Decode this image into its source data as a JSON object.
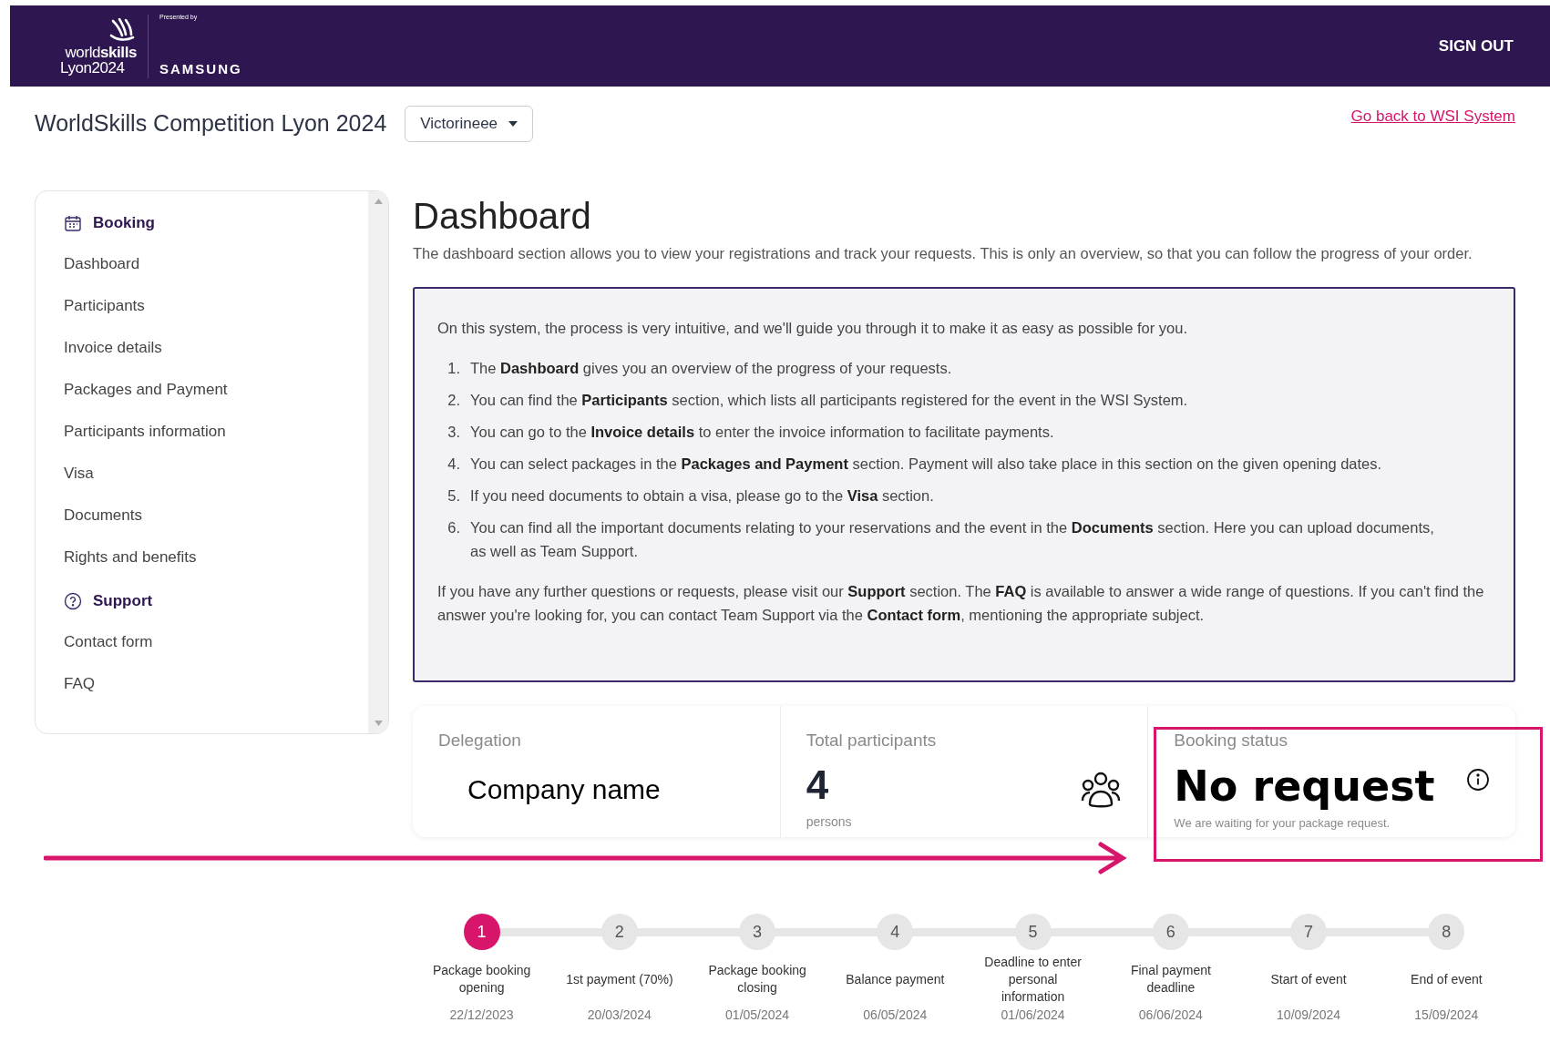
{
  "header": {
    "logo_line_1_light": "world",
    "logo_line_1_bold": "skills",
    "logo_line_2": "Lyon2024",
    "presented_by": "Presented by",
    "sponsor": "SAMSUNG",
    "sign_out": "SIGN OUT"
  },
  "title_bar": {
    "title": "WorldSkills Competition Lyon 2024",
    "dropdown": "Victorineee",
    "back_link": "Go back to WSI System"
  },
  "sidebar": {
    "sections": [
      {
        "title": "Booking",
        "kind": "calendar",
        "items": [
          {
            "label": "Dashboard"
          },
          {
            "label": "Participants"
          },
          {
            "label": "Invoice details"
          },
          {
            "label": "Packages and Payment"
          },
          {
            "label": "Participants information"
          },
          {
            "label": "Visa"
          },
          {
            "label": "Documents"
          },
          {
            "label": "Rights and benefits"
          }
        ]
      },
      {
        "title": "Support",
        "kind": "help",
        "items": [
          {
            "label": "Contact form"
          },
          {
            "label": "FAQ"
          }
        ]
      }
    ]
  },
  "main": {
    "heading": "Dashboard",
    "description": "The dashboard section allows you to view your registrations and track your requests. This is only an overview, so that you can follow the progress of your order.",
    "info": {
      "intro": "On this system, the process is very intuitive, and we'll guide you through it to make it as easy as possible for you.",
      "steps": [
        {
          "number": "1.",
          "text": "The **Dashboard** gives you an overview of the progress of your requests."
        },
        {
          "number": "2.",
          "text": "You can find the **Participants** section, which lists all participants registered for the event in the WSI System."
        },
        {
          "number": "3.",
          "text": "You can go to the **Invoice details** to enter the invoice information to facilitate payments."
        },
        {
          "number": "4.",
          "text": "You can select packages in the **Packages and Payment** section. Payment will also take place in this section on the given opening dates."
        },
        {
          "number": "5.",
          "text": "If you need documents to obtain a visa, please go to the **Visa** section."
        },
        {
          "number": "6.",
          "text": "You can find all the important documents relating to your reservations and the event in the **Documents** section. Here you can upload documents, as well as Team Support."
        }
      ],
      "outro": "If you have any further questions or requests, please visit our **Support** section. The **FAQ** is available to answer a wide range of questions. If you can't find the answer you're looking for, you can contact Team Support via the **Contact form**, mentioning the appropriate subject."
    },
    "cards": [
      {
        "kind": "delegation",
        "label": "Delegation",
        "value": "Company name"
      },
      {
        "kind": "participants",
        "label": "Total participants",
        "value": "4",
        "unit": "persons"
      },
      {
        "kind": "status",
        "label": "Booking status",
        "value": "No request",
        "note": "We are waiting for your package request."
      }
    ],
    "timeline": [
      {
        "number": "1",
        "label": "Package booking opening",
        "date": "22/12/2023",
        "selected": true
      },
      {
        "number": "2",
        "label": "1st payment (70%)",
        "date": "20/03/2024",
        "selected": false
      },
      {
        "number": "3",
        "label": "Package booking closing",
        "date": "01/05/2024",
        "selected": false
      },
      {
        "number": "4",
        "label": "Balance payment",
        "date": "06/05/2024",
        "selected": false
      },
      {
        "number": "5",
        "label": "Deadline to enter personal information",
        "date": "01/06/2024",
        "selected": false
      },
      {
        "number": "6",
        "label": "Final payment deadline",
        "date": "06/06/2024",
        "selected": false
      },
      {
        "number": "7",
        "label": "Start of event",
        "date": "10/09/2024",
        "selected": false
      },
      {
        "number": "8",
        "label": "End of event",
        "date": "15/09/2024",
        "selected": false
      }
    ]
  }
}
